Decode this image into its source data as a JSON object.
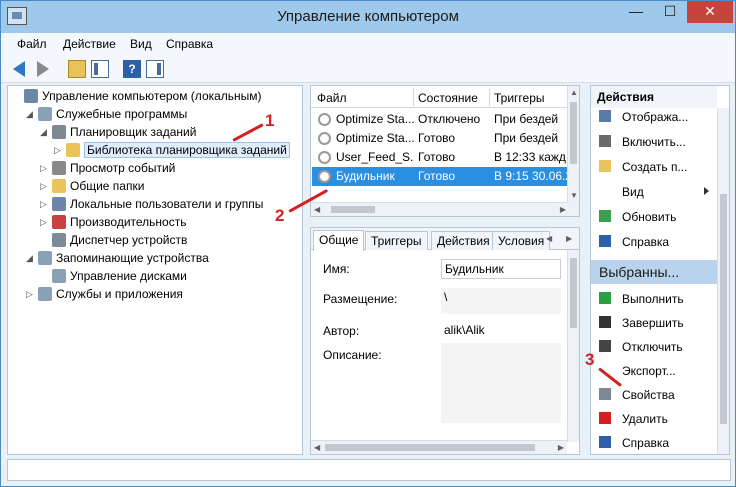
{
  "window": {
    "title": "Управление компьютером"
  },
  "titlebar": {
    "minimize": "—",
    "maximize": "☐",
    "close": "✕"
  },
  "menu": [
    "Файл",
    "Действие",
    "Вид",
    "Справка"
  ],
  "tree": {
    "nodes": [
      {
        "label": "Управление компьютером (локальным)",
        "level": 0,
        "expander": "",
        "icon_color": "#6b87a8",
        "icon": "computer-icon"
      },
      {
        "label": "Служебные программы",
        "level": 1,
        "expander": "◢",
        "icon_color": "#8aa0b6",
        "icon": "tools-icon"
      },
      {
        "label": "Планировщик заданий",
        "level": 2,
        "expander": "◢",
        "icon_color": "#7d8a96",
        "icon": "clock-icon"
      },
      {
        "label": "Библиотека планировщика заданий",
        "level": 3,
        "expander": "▷",
        "icon_color": "#e8c45a",
        "icon": "folder-clock-icon",
        "selected": true
      },
      {
        "label": "Просмотр событий",
        "level": 2,
        "expander": "▷",
        "icon_color": "#8a8a8a",
        "icon": "event-viewer-icon"
      },
      {
        "label": "Общие папки",
        "level": 2,
        "expander": "▷",
        "icon_color": "#e8c45a",
        "icon": "shared-folder-icon"
      },
      {
        "label": "Локальные пользователи и группы",
        "level": 2,
        "expander": "▷",
        "icon_color": "#6b87a8",
        "icon": "users-icon"
      },
      {
        "label": "Производительность",
        "level": 2,
        "expander": "▷",
        "icon_color": "#c94040",
        "icon": "performance-icon"
      },
      {
        "label": "Диспетчер устройств",
        "level": 2,
        "expander": "",
        "icon_color": "#7d8a96",
        "icon": "device-manager-icon"
      },
      {
        "label": "Запоминающие устройства",
        "level": 1,
        "expander": "◢",
        "icon_color": "#8aa0b6",
        "icon": "storage-icon"
      },
      {
        "label": "Управление дисками",
        "level": 2,
        "expander": "",
        "icon_color": "#8aa0b6",
        "icon": "disk-icon"
      },
      {
        "label": "Службы и приложения",
        "level": 1,
        "expander": "▷",
        "icon_color": "#8aa0b6",
        "icon": "services-icon"
      }
    ]
  },
  "tasks": {
    "columns": [
      "Файл",
      "Состояние",
      "Триггеры"
    ],
    "rows": [
      {
        "name": "Optimize Sta...",
        "state": "Отключено",
        "trigger": "При бездей"
      },
      {
        "name": "Optimize Sta...",
        "state": "Готово",
        "trigger": "При бездей"
      },
      {
        "name": "User_Feed_S...",
        "state": "Готово",
        "trigger": "В 12:33 кажд"
      },
      {
        "name": "Будильник",
        "state": "Готово",
        "trigger": "В 9:15 30.06.2",
        "selected": true
      }
    ]
  },
  "properties": {
    "tabs": [
      "Общие",
      "Триггеры",
      "Действия",
      "Условия"
    ],
    "fields": {
      "name_label": "Имя:",
      "name_value": "Будильник",
      "location_label": "Размещение:",
      "location_value": "\\",
      "author_label": "Автор:",
      "author_value": "alik\\Alik",
      "description_label": "Описание:",
      "description_value": ""
    }
  },
  "actions": {
    "header": "Действия",
    "items_top": [
      {
        "label": "Отобража...",
        "icon": "display-icon",
        "color": "#5a7aa8"
      },
      {
        "label": "Включить...",
        "icon": "enable-icon",
        "color": "#6a6a6a"
      },
      {
        "label": "Создать п...",
        "icon": "new-folder-icon",
        "color": "#e8c45a"
      },
      {
        "label": "Вид",
        "icon": "",
        "color": "",
        "submenu": true
      },
      {
        "label": "Обновить",
        "icon": "refresh-icon",
        "color": "#3aa050"
      },
      {
        "label": "Справка",
        "icon": "help-icon",
        "color": "#2e5fa9"
      }
    ],
    "selected_header": "Выбранны...",
    "items_selected": [
      {
        "label": "Выполнить",
        "icon": "run-icon",
        "color": "#2ca040"
      },
      {
        "label": "Завершить",
        "icon": "stop-icon",
        "color": "#333333"
      },
      {
        "label": "Отключить",
        "icon": "disable-icon",
        "color": "#444444"
      },
      {
        "label": "Экспорт...",
        "icon": "",
        "color": ""
      },
      {
        "label": "Свойства",
        "icon": "properties-icon",
        "color": "#7d8a96"
      },
      {
        "label": "Удалить",
        "icon": "delete-icon",
        "color": "#d42020"
      },
      {
        "label": "Справка",
        "icon": "help-icon",
        "color": "#2e5fa9"
      }
    ]
  },
  "annotations": [
    "1",
    "2",
    "3"
  ],
  "colors": {
    "accent": "#2a8fe0",
    "annotation": "#d42020",
    "close": "#c7443a"
  }
}
